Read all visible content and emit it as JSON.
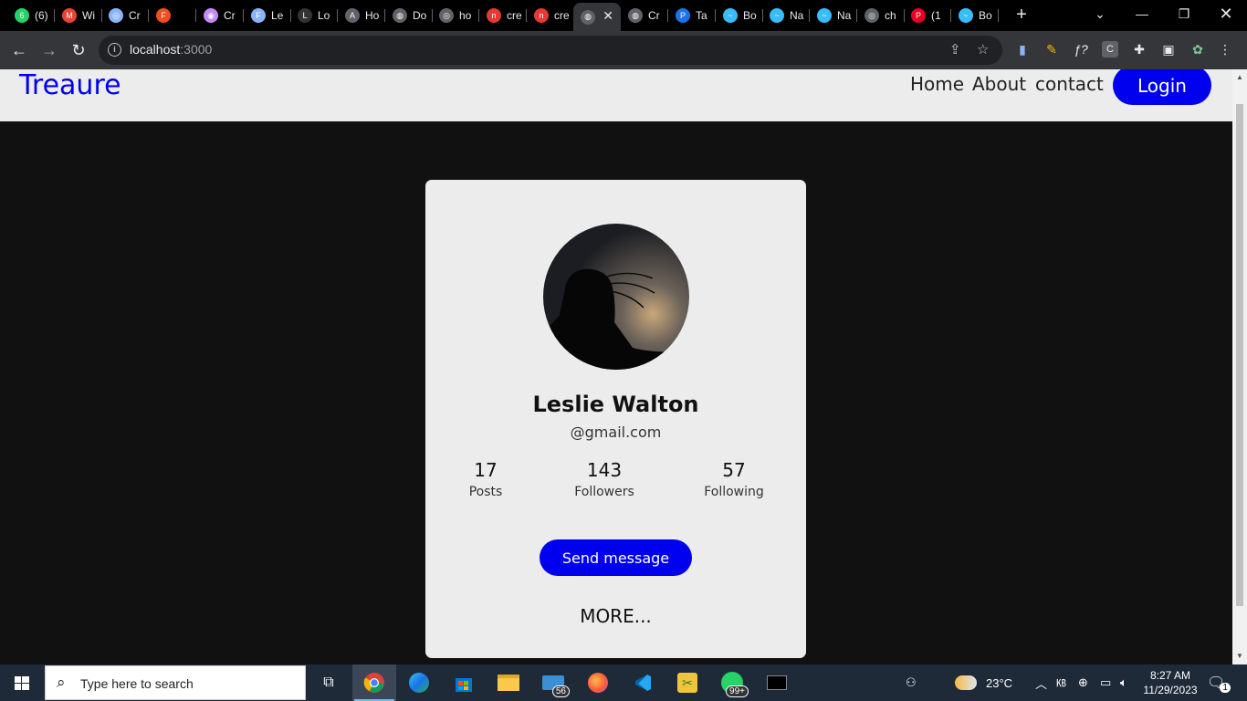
{
  "browser": {
    "tabs": [
      {
        "label": "(6)",
        "color": "#25d366",
        "glyph": "6"
      },
      {
        "label": "Wi",
        "color": "#ea4335",
        "glyph": "M"
      },
      {
        "label": "Cr",
        "color": "#8ab4f8",
        "glyph": "◎"
      },
      {
        "label": "",
        "color": "#f24e1e",
        "glyph": "F"
      },
      {
        "label": "Cr",
        "color": "#c58af9",
        "glyph": "◉"
      },
      {
        "label": "Le",
        "color": "#8ab4f8",
        "glyph": "F"
      },
      {
        "label": "Lo",
        "color": "#333333",
        "glyph": "L"
      },
      {
        "label": "Ho",
        "color": "#5f6368",
        "glyph": "A"
      },
      {
        "label": "Do",
        "color": "#5f6368",
        "glyph": "◍"
      },
      {
        "label": "ho",
        "color": "#5f6368",
        "glyph": "◎"
      },
      {
        "label": "cre",
        "color": "#e53935",
        "glyph": "n"
      },
      {
        "label": "cre",
        "color": "#e53935",
        "glyph": "n"
      },
      {
        "label": "",
        "color": "#5f6368",
        "glyph": "◍"
      },
      {
        "label": "Cr",
        "color": "#5f6368",
        "glyph": "◍"
      },
      {
        "label": "Ta",
        "color": "#1a73e8",
        "glyph": "P"
      },
      {
        "label": "Bo",
        "color": "#38bdf8",
        "glyph": "~"
      },
      {
        "label": "Na",
        "color": "#38bdf8",
        "glyph": "~"
      },
      {
        "label": "Na",
        "color": "#38bdf8",
        "glyph": "~"
      },
      {
        "label": "ch",
        "color": "#5f6368",
        "glyph": "◎"
      },
      {
        "label": "(1",
        "color": "#e60023",
        "glyph": "P"
      },
      {
        "label": "Bo",
        "color": "#38bdf8",
        "glyph": "~"
      }
    ],
    "active_tab_index": 12,
    "url_host": "localhost",
    "url_port": ":3000"
  },
  "site": {
    "logo": "Treaure",
    "nav": [
      "Home",
      "About",
      "contact"
    ],
    "login_label": "Login"
  },
  "profile": {
    "name": "Leslie Walton",
    "email": "@gmail.com",
    "stats": [
      {
        "value": "17",
        "label": "Posts"
      },
      {
        "value": "143",
        "label": "Followers"
      },
      {
        "value": "57",
        "label": "Following"
      }
    ],
    "send_label": "Send message",
    "more_label": "MORE..."
  },
  "taskbar": {
    "search_placeholder": "Type here to search",
    "mail_badge": "56",
    "whatsapp_badge": "99+",
    "temperature": "23°C",
    "time": "8:27 AM",
    "date": "11/29/2023",
    "notification_count": "1"
  },
  "colors": {
    "accent": "#0000ee",
    "page_bg": "#111111",
    "card_bg": "#ececec"
  }
}
